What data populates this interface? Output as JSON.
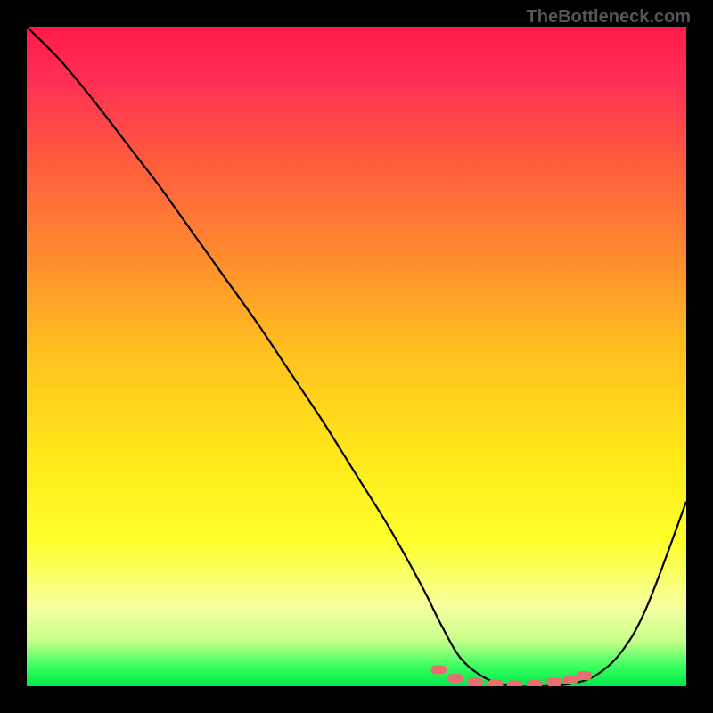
{
  "watermark": "TheBottleneck.com",
  "chart_data": {
    "type": "line",
    "title": "",
    "xlabel": "",
    "ylabel": "",
    "xlim": [
      0,
      100
    ],
    "ylim": [
      0,
      100
    ],
    "grid": false,
    "background": "rainbow-gradient-vertical",
    "series": [
      {
        "name": "bottleneck-curve",
        "color": "#000000",
        "x": [
          0,
          5,
          10,
          15,
          20,
          25,
          30,
          35,
          40,
          45,
          50,
          55,
          60,
          63,
          66,
          70,
          74,
          78,
          82,
          86,
          90,
          94,
          100
        ],
        "y": [
          100,
          95,
          89,
          82.5,
          76,
          69,
          62,
          55,
          47.5,
          40,
          32,
          24,
          15,
          9,
          4,
          1,
          0,
          0,
          0.3,
          1.5,
          5,
          12,
          28
        ]
      }
    ],
    "markers": {
      "name": "valley-dots",
      "color": "#e67070",
      "x": [
        62.5,
        65,
        68,
        71,
        74,
        77,
        80,
        82.5,
        84.5
      ],
      "y": [
        2.5,
        1.2,
        0.6,
        0.3,
        0.2,
        0.3,
        0.6,
        1.0,
        1.6
      ]
    }
  }
}
